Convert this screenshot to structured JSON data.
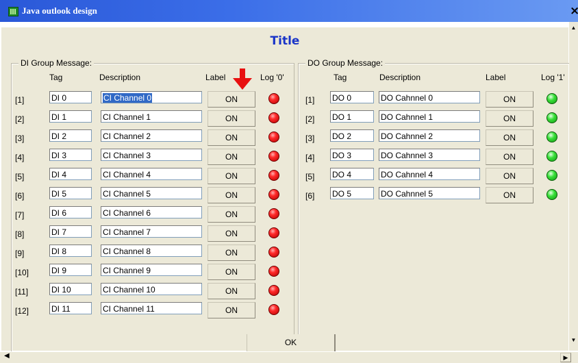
{
  "window": {
    "title": "Java outlook design",
    "close_label": "×"
  },
  "dialog_title": "Title",
  "di_group": {
    "legend": "DI Group Message:",
    "headers": {
      "tag": "Tag",
      "description": "Description",
      "label": "Label",
      "log": "Log '0'"
    },
    "rows": [
      {
        "index": "[1]",
        "tag": "DI 0",
        "description": "CI Channel 0",
        "button": "ON"
      },
      {
        "index": "[2]",
        "tag": "DI 1",
        "description": "CI Channel 1",
        "button": "ON"
      },
      {
        "index": "[3]",
        "tag": "DI 2",
        "description": "CI Channel 2",
        "button": "ON"
      },
      {
        "index": "[4]",
        "tag": "DI 3",
        "description": "CI Channel 3",
        "button": "ON"
      },
      {
        "index": "[5]",
        "tag": "DI 4",
        "description": "CI Channel 4",
        "button": "ON"
      },
      {
        "index": "[6]",
        "tag": "DI 5",
        "description": "CI Channel 5",
        "button": "ON"
      },
      {
        "index": "[7]",
        "tag": "DI 6",
        "description": "CI Channel 6",
        "button": "ON"
      },
      {
        "index": "[8]",
        "tag": "DI 7",
        "description": "CI Channel 7",
        "button": "ON"
      },
      {
        "index": "[9]",
        "tag": "DI 8",
        "description": "CI Channel 8",
        "button": "ON"
      },
      {
        "index": "[10]",
        "tag": "DI 9",
        "description": "CI Channel 9",
        "button": "ON"
      },
      {
        "index": "[11]",
        "tag": "DI 10",
        "description": "CI Channel 10",
        "button": "ON"
      },
      {
        "index": "[12]",
        "tag": "DI 11",
        "description": "CI Channel 11",
        "button": "ON"
      }
    ],
    "led_color": "#e01010"
  },
  "do_group": {
    "legend": "DO Group Message:",
    "headers": {
      "tag": "Tag",
      "description": "Description",
      "label": "Label",
      "log": "Log '1'"
    },
    "rows": [
      {
        "index": "[1]",
        "tag": "DO 0",
        "description": "DO Cahnnel 0",
        "button": "ON"
      },
      {
        "index": "[2]",
        "tag": "DO 1",
        "description": "DO Cahnnel 1",
        "button": "ON"
      },
      {
        "index": "[3]",
        "tag": "DO 2",
        "description": "DO Cahnnel 2",
        "button": "ON"
      },
      {
        "index": "[4]",
        "tag": "DO 3",
        "description": "DO Cahnnel 3",
        "button": "ON"
      },
      {
        "index": "[5]",
        "tag": "DO 4",
        "description": "DO Cahnnel 4",
        "button": "ON"
      },
      {
        "index": "[6]",
        "tag": "DO 5",
        "description": "DO Cahnnel 5",
        "button": "ON"
      }
    ],
    "led_color": "#22cc22"
  },
  "ok_label": "OK",
  "icons": {
    "app": "app-icon",
    "arrow": "red-arrow-annotation",
    "led_off": "red-led-icon",
    "led_on": "green-led-icon"
  },
  "colors": {
    "titlebar": "#3b6ee8",
    "dialog_title": "#1a35c8",
    "face": "#ece9d8",
    "selection": "#3169c6"
  }
}
